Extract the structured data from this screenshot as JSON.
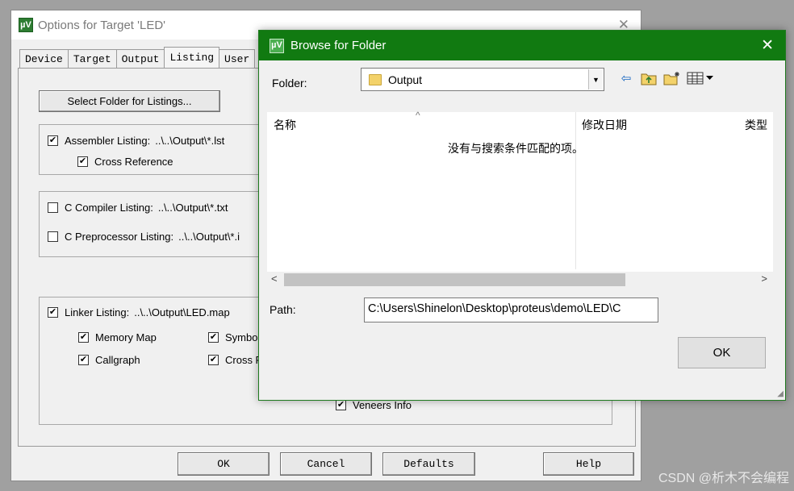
{
  "options_window": {
    "title": "Options for Target 'LED'",
    "close_glyph": "✕",
    "tabs": [
      "Device",
      "Target",
      "Output",
      "Listing",
      "User"
    ],
    "active_tab": "Listing",
    "select_folder_button": "Select Folder for Listings...",
    "assembler_listing": {
      "label": "Assembler Listing:",
      "path": "..\\..\\Output\\*.lst",
      "checked": true
    },
    "cross_reference": {
      "label": "Cross Reference",
      "checked": true
    },
    "c_compiler_listing": {
      "label": "C Compiler Listing:",
      "path": "..\\..\\Output\\*.txt",
      "checked": false
    },
    "c_preprocessor_listing": {
      "label": "C Preprocessor Listing:",
      "path": "..\\..\\Output\\*.i",
      "checked": false
    },
    "linker_listing": {
      "label": "Linker Listing:",
      "path": "..\\..\\Output\\LED.map",
      "checked": true
    },
    "memory_map": {
      "label": "Memory Map",
      "checked": true
    },
    "callgraph": {
      "label": "Callgraph",
      "checked": true
    },
    "symbols": {
      "label": "Symbol",
      "checked": true
    },
    "cross_ref_linker": {
      "label": "Cross F",
      "checked": true
    },
    "veneers_info": {
      "label": "Veneers Info",
      "checked": true
    },
    "buttons": {
      "ok": "OK",
      "cancel": "Cancel",
      "defaults": "Defaults",
      "help": "Help"
    }
  },
  "browse_dialog": {
    "title": "Browse for Folder",
    "close_glyph": "✕",
    "folder_label": "Folder:",
    "folder_value": "Output",
    "columns": [
      "名称",
      "修改日期",
      "类型"
    ],
    "empty_message": "没有与搜索条件匹配的项。",
    "path_label": "Path:",
    "path_value": "C:\\Users\\Shinelon\\Desktop\\proteus\\demo\\LED\\C",
    "ok_button": "OK"
  },
  "icons": {
    "app_icon": "µV",
    "back_icon": "⇦",
    "up_folder_icon": "up-folder",
    "new_folder_icon": "new-folder",
    "view_menu_icon": "view-menu"
  },
  "watermark": "CSDN @析木不会编程",
  "colors": {
    "title_green": "#117a11"
  }
}
